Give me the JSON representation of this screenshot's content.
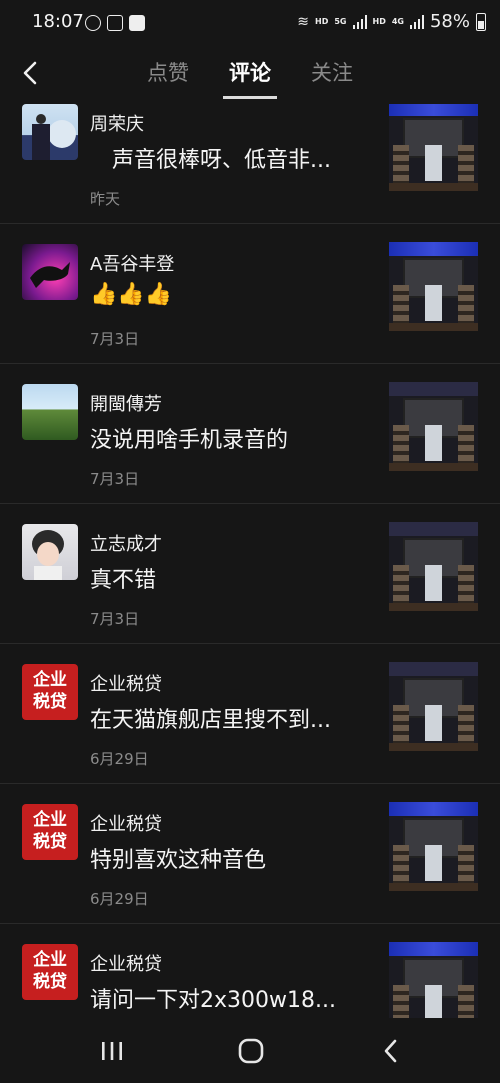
{
  "status_bar": {
    "time": "18:07",
    "hd1": "HD",
    "net1": "5G",
    "hd2": "HD",
    "net2": "4G",
    "battery": "58%"
  },
  "header": {
    "back_icon": "chevron-left-icon",
    "tabs": [
      {
        "label": "点赞",
        "active": false
      },
      {
        "label": "评论",
        "active": true
      },
      {
        "label": "关注",
        "active": false
      }
    ]
  },
  "comments": [
    {
      "name": "周荣庆",
      "text": "　声音很棒呀、低音非...",
      "date": "昨天",
      "avatar": "portrait"
    },
    {
      "name": "A吾谷丰登",
      "text": "",
      "emoji": [
        "👍",
        "👍",
        "👍"
      ],
      "date": "7月3日",
      "avatar": "horse"
    },
    {
      "name": "開閩傳芳",
      "text": "没说用啥手机录音的",
      "date": "7月3日",
      "avatar": "landscape"
    },
    {
      "name": "立志成才",
      "text": "真不错",
      "date": "7月3日",
      "avatar": "cartoon"
    },
    {
      "name": "企业税贷",
      "text": "在天猫旗舰店里搜不到...",
      "date": "6月29日",
      "avatar": "badge",
      "badge_line1": "企业",
      "badge_line2": "税贷"
    },
    {
      "name": "企业税贷",
      "text": "特别喜欢这种音色",
      "date": "6月29日",
      "avatar": "badge",
      "badge_line1": "企业",
      "badge_line2": "税贷"
    },
    {
      "name": "企业税贷",
      "text": "请问一下对2x300w18...",
      "date": "",
      "avatar": "badge",
      "badge_line1": "企业",
      "badge_line2": "税贷"
    }
  ],
  "nav_bar": {
    "recent_icon": "recent-apps-icon",
    "home_icon": "home-icon",
    "back_icon": "back-icon"
  }
}
